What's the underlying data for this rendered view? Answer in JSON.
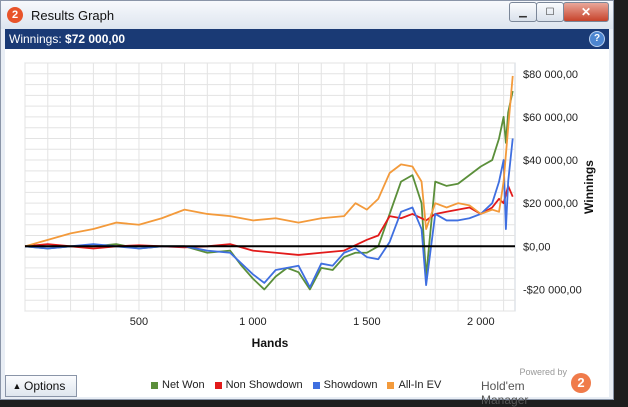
{
  "window": {
    "title": "Results Graph",
    "app_icon": "2"
  },
  "header": {
    "label": "Winnings:",
    "value": "$72 000,00",
    "help": "?"
  },
  "chart_data": {
    "type": "line",
    "xlabel": "Hands",
    "ylabel": "Winnings",
    "xlim": [
      0,
      2150
    ],
    "ylim": [
      -30000,
      85000
    ],
    "x_ticks": [
      500,
      1000,
      1500,
      2000
    ],
    "x_tick_labels": [
      "500",
      "1 000",
      "1 500",
      "2 000"
    ],
    "y_ticks": [
      -20000,
      0,
      20000,
      40000,
      60000,
      80000
    ],
    "y_tick_labels": [
      "-$20 000,00",
      "$0,00",
      "$20 000,00",
      "$40 000,00",
      "$60 000,00",
      "$80 000,00"
    ],
    "grid": true,
    "legend_position": "bottom",
    "series": [
      {
        "name": "Net Won",
        "color": "#5b8f3a",
        "x": [
          0,
          100,
          200,
          300,
          400,
          500,
          600,
          700,
          800,
          900,
          950,
          1000,
          1050,
          1100,
          1150,
          1200,
          1250,
          1300,
          1350,
          1400,
          1450,
          1500,
          1550,
          1600,
          1650,
          1700,
          1740,
          1760,
          1800,
          1850,
          1900,
          1950,
          2000,
          2050,
          2080,
          2100,
          2110,
          2120,
          2140
        ],
        "y": [
          0,
          -1000,
          0,
          0,
          1000,
          -1000,
          0,
          0,
          -3000,
          -2000,
          -9000,
          -15000,
          -20000,
          -14000,
          -10000,
          -12000,
          -20000,
          -10000,
          -11000,
          -5000,
          -3000,
          -3000,
          0,
          15000,
          30000,
          33000,
          20000,
          -14000,
          30000,
          28000,
          29000,
          33000,
          37000,
          40000,
          50000,
          60000,
          48000,
          62000,
          72000
        ]
      },
      {
        "name": "Non Showdown",
        "color": "#e21a1a",
        "x": [
          0,
          100,
          200,
          300,
          400,
          500,
          600,
          700,
          800,
          900,
          1000,
          1100,
          1200,
          1300,
          1400,
          1500,
          1550,
          1600,
          1650,
          1700,
          1760,
          1800,
          1850,
          1900,
          1950,
          2000,
          2050,
          2080,
          2100,
          2120,
          2140
        ],
        "y": [
          0,
          1000,
          0,
          -1000,
          0,
          500,
          0,
          -500,
          0,
          1000,
          -2000,
          -3000,
          -4000,
          -3000,
          -2000,
          3000,
          5000,
          14000,
          13000,
          15000,
          12000,
          15000,
          16000,
          17000,
          18000,
          15000,
          18000,
          22000,
          20000,
          28000,
          23000
        ]
      },
      {
        "name": "Showdown",
        "color": "#3f6fe0",
        "x": [
          0,
          100,
          200,
          300,
          400,
          500,
          600,
          700,
          800,
          900,
          950,
          1000,
          1050,
          1100,
          1150,
          1200,
          1250,
          1300,
          1350,
          1400,
          1450,
          1500,
          1550,
          1600,
          1650,
          1700,
          1740,
          1760,
          1800,
          1850,
          1900,
          1950,
          2000,
          2050,
          2080,
          2100,
          2110,
          2120,
          2140
        ],
        "y": [
          0,
          -1000,
          0,
          1000,
          0,
          -1000,
          0,
          0,
          -2000,
          -3000,
          -8000,
          -13000,
          -17000,
          -11000,
          -10000,
          -9000,
          -19000,
          -8000,
          -9000,
          -3000,
          -1000,
          -5000,
          -6000,
          2000,
          16000,
          18000,
          8000,
          -18000,
          15000,
          12000,
          12000,
          13000,
          15000,
          20000,
          30000,
          40000,
          8000,
          30000,
          50000
        ]
      },
      {
        "name": "All-In EV",
        "color": "#f39a3b",
        "x": [
          0,
          100,
          200,
          300,
          400,
          500,
          600,
          700,
          800,
          900,
          1000,
          1100,
          1200,
          1300,
          1400,
          1450,
          1500,
          1550,
          1600,
          1650,
          1700,
          1740,
          1760,
          1800,
          1850,
          1900,
          1950,
          2000,
          2050,
          2080,
          2100,
          2120,
          2140
        ],
        "y": [
          0,
          3000,
          6000,
          8000,
          11000,
          10000,
          13000,
          17000,
          15000,
          14000,
          12000,
          13000,
          11000,
          13000,
          14000,
          20000,
          17000,
          22000,
          34000,
          38000,
          37000,
          30000,
          8000,
          20000,
          18000,
          20000,
          19000,
          15000,
          17000,
          16000,
          30000,
          55000,
          79000
        ]
      }
    ]
  },
  "bottom": {
    "options_label": "Options",
    "options_arrow": "▲",
    "powered": "Powered by",
    "brand": "Hold'em Manager",
    "brand_logo": "2"
  },
  "icons": {
    "close": "close-icon",
    "minimize": "minimize-icon",
    "maximize": "maximize-icon"
  }
}
